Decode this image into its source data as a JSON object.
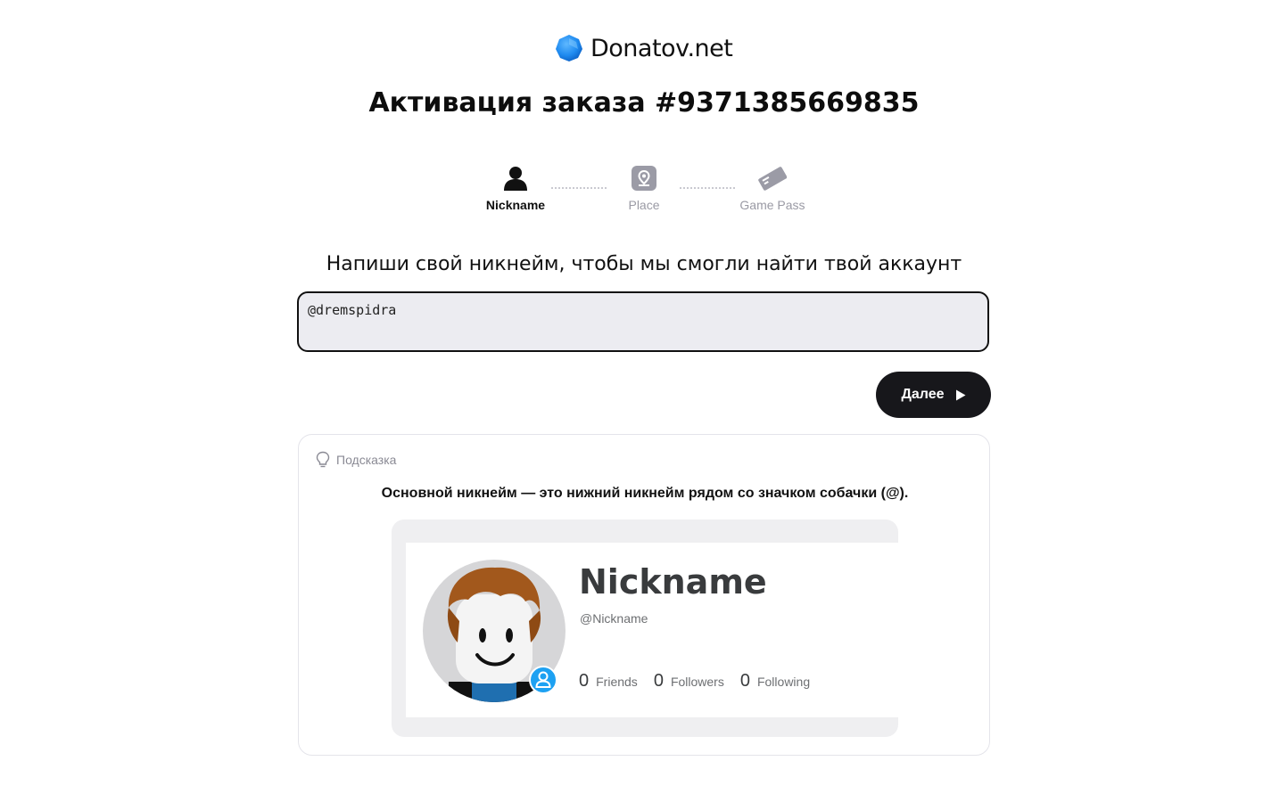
{
  "brand": {
    "name": "Donatov.net"
  },
  "page": {
    "title": "Активация заказа #9371385669835"
  },
  "steps": [
    {
      "label": "Nickname",
      "icon": "user-icon",
      "state": "active"
    },
    {
      "label": "Place",
      "icon": "map-pin-icon",
      "state": "inactive"
    },
    {
      "label": "Game Pass",
      "icon": "ticket-icon",
      "state": "inactive"
    }
  ],
  "form": {
    "prompt": "Напиши свой никнейм, чтобы мы смогли найти твой аккаунт",
    "nickname_value": "@dremspidra",
    "next_label": "Далее"
  },
  "hint": {
    "label": "Подсказка",
    "text": "Основной никнейм — это нижний никнейм рядом со значком собачки (@).",
    "example_profile": {
      "display_name": "Nickname",
      "handle": "@Nickname",
      "stats": [
        {
          "value": "0",
          "label": "Friends"
        },
        {
          "value": "0",
          "label": "Followers"
        },
        {
          "value": "0",
          "label": "Following"
        }
      ]
    }
  },
  "colors": {
    "accent": "#1f8bf0",
    "button": "#17171b",
    "input_bg": "#ececf1",
    "badge": "#1da1f2"
  }
}
